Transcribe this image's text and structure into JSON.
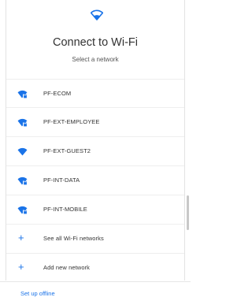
{
  "header": {
    "icon": "wifi-icon",
    "title": "Connect to Wi-Fi",
    "subtitle": "Select a network"
  },
  "networks": [
    {
      "name": "PF-ECOM",
      "icon": "wifi-locked-icon"
    },
    {
      "name": "PF-EXT-EMPLOYEE",
      "icon": "wifi-locked-icon"
    },
    {
      "name": "PF-EXT-GUEST2",
      "icon": "wifi-icon"
    },
    {
      "name": "PF-INT-DATA",
      "icon": "wifi-locked-icon"
    },
    {
      "name": "PF-INT-MOBILE",
      "icon": "wifi-locked-icon"
    }
  ],
  "actions": {
    "see_all": "See all Wi-Fi networks",
    "add_new": "Add new network",
    "plus_glyph": "+"
  },
  "footer": {
    "setup_offline": "Set up offline"
  },
  "colors": {
    "accent": "#1a73e8"
  }
}
